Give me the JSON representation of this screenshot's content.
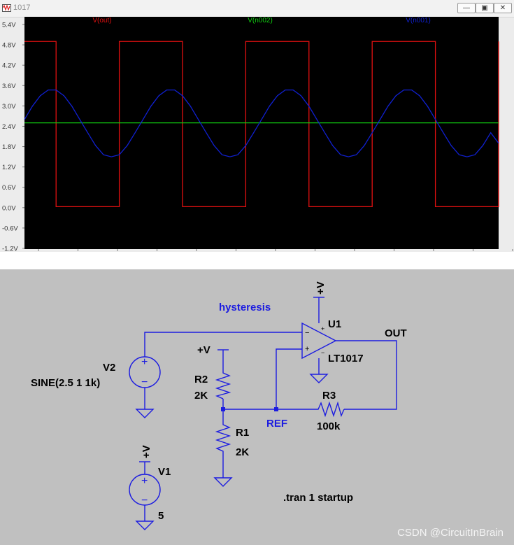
{
  "window": {
    "title": "1017",
    "minimize_icon": "minimize-icon",
    "maximize_icon": "maximize-icon",
    "close_icon": "close-icon"
  },
  "chart_data": {
    "type": "line",
    "title": "",
    "xlabel": "",
    "ylabel": "",
    "ylim": [
      -1.2,
      5.4
    ],
    "y_ticks": [
      "5.4V",
      "4.8V",
      "4.2V",
      "3.6V",
      "3.0V",
      "2.4V",
      "1.8V",
      "1.2V",
      "0.6V",
      "0.0V",
      "-0.6V",
      "-1.2V"
    ],
    "grid": false,
    "background": "#000000",
    "x": [
      0,
      0.125,
      0.25,
      0.375,
      0.5,
      0.625,
      0.75,
      0.875,
      1,
      1.125,
      1.25,
      1.375,
      1.5,
      1.625,
      1.75,
      1.875,
      2,
      2.125,
      2.25,
      2.375,
      2.5,
      2.625,
      2.75,
      2.875,
      3,
      3.125,
      3.25,
      3.375,
      3.5,
      3.625,
      3.75,
      3.875,
      4,
      4.125,
      4.25,
      4.375,
      4.5,
      4.625,
      4.75,
      4.875,
      5,
      5.125,
      5.25,
      5.375,
      5.5,
      5.625,
      5.75,
      5.875,
      6,
      6.125,
      6.25,
      6.375,
      6.5,
      6.625,
      6.75,
      6.875,
      7,
      7.125,
      7.25,
      7.375,
      7.5
    ],
    "series": [
      {
        "name": "V(out)",
        "color": "#e01010",
        "kind": "square",
        "high": 4.9,
        "low": 0.03,
        "edges": [
          0.5,
          1.5,
          2.5,
          3.5,
          4.5,
          5.5,
          6.5,
          7.5
        ]
      },
      {
        "name": "V(n002)",
        "color": "#10d010",
        "values": [
          2.5,
          2.5,
          2.5,
          2.5,
          2.5,
          2.5,
          2.5,
          2.5,
          2.5,
          2.5,
          2.5,
          2.5,
          2.5,
          2.5,
          2.5,
          2.5,
          2.5,
          2.5,
          2.5,
          2.5,
          2.5,
          2.5,
          2.5,
          2.5,
          2.5,
          2.5,
          2.5,
          2.5,
          2.5,
          2.5,
          2.5,
          2.5,
          2.5,
          2.5,
          2.5,
          2.5,
          2.5,
          2.5,
          2.5,
          2.5,
          2.5,
          2.5,
          2.5,
          2.5,
          2.5,
          2.5,
          2.5,
          2.5,
          2.5,
          2.5,
          2.5,
          2.5,
          2.5,
          2.5,
          2.5,
          2.5,
          2.5,
          2.5,
          2.5,
          2.5,
          2.5
        ]
      },
      {
        "name": "V(n001)",
        "color": "#1020d0",
        "values": [
          2.6,
          2.99,
          3.3,
          3.47,
          3.47,
          3.3,
          2.99,
          2.6,
          2.21,
          1.83,
          1.56,
          1.5,
          1.56,
          1.83,
          2.21,
          2.6,
          2.99,
          3.3,
          3.47,
          3.47,
          3.3,
          2.99,
          2.6,
          2.21,
          1.83,
          1.56,
          1.5,
          1.56,
          1.83,
          2.21,
          2.6,
          2.99,
          3.3,
          3.47,
          3.47,
          3.3,
          2.99,
          2.6,
          2.21,
          1.83,
          1.56,
          1.5,
          1.56,
          1.83,
          2.21,
          2.6,
          2.99,
          3.3,
          3.47,
          3.47,
          3.3,
          2.99,
          2.6,
          2.21,
          1.83,
          1.56,
          1.5,
          1.56,
          1.83,
          2.21,
          1.9
        ]
      }
    ]
  },
  "schematic": {
    "net_label": "hysteresis",
    "u1_name": "U1",
    "u1_model": "LT1017",
    "out_label": "OUT",
    "ref_label": "REF",
    "v2_name": "V2",
    "v2_value": "SINE(2.5 1 1k)",
    "v1_name": "V1",
    "v1_value": "5",
    "r1_name": "R1",
    "r1_value": "2K",
    "r2_name": "R2",
    "r2_value": "2K",
    "r3_name": "R3",
    "r3_value": "100k",
    "supply_label": "+V",
    "supply_u1": "+V",
    "supply_r2": "+V",
    "supply_v1": "+V",
    "directive": ".tran 1 startup",
    "plus_sign": "+",
    "minus_sign": "−",
    "opamp_plus_in": "+",
    "opamp_minus_in": "−"
  },
  "watermark": "CSDN @CircuitInBrain"
}
